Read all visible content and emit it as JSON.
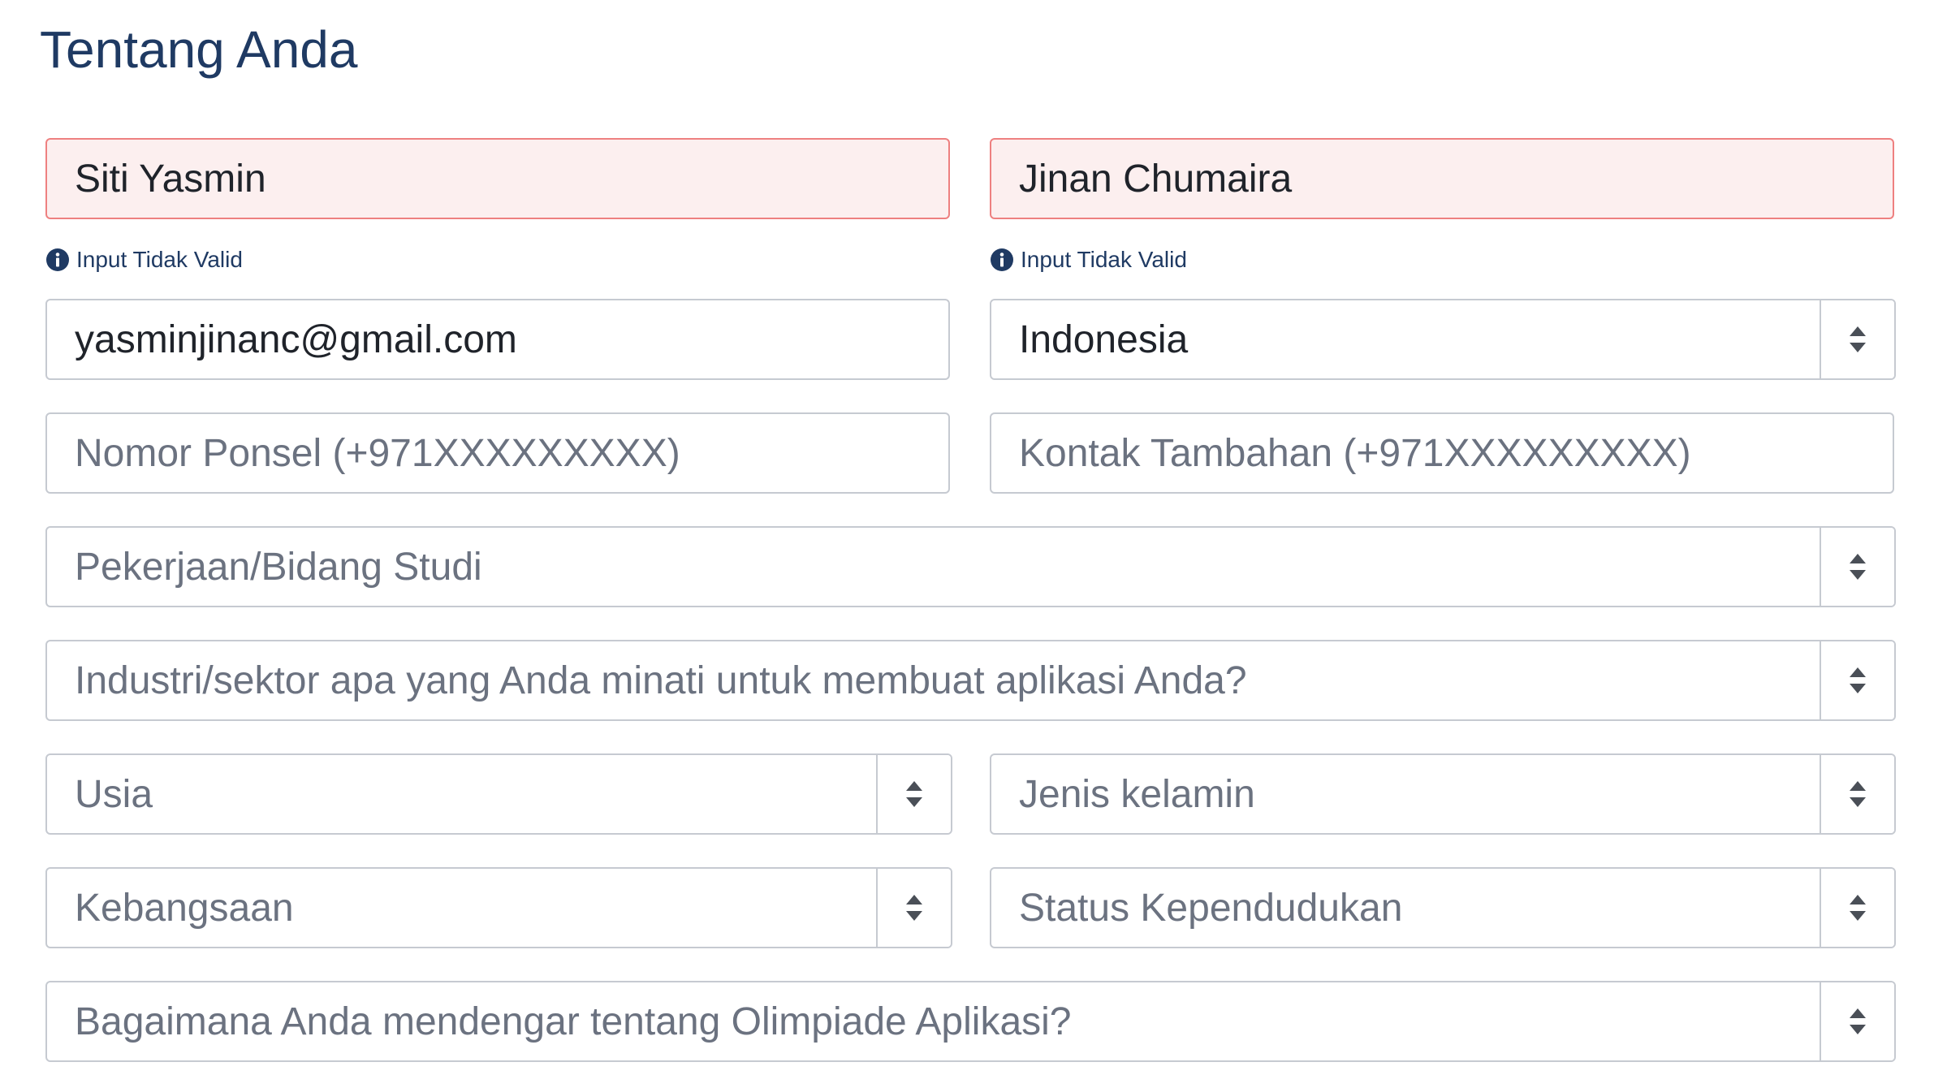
{
  "page_title": "Tentang Anda",
  "first_name": {
    "value": "Siti Yasmin",
    "error": "Input Tidak Valid"
  },
  "last_name": {
    "value": "Jinan Chumaira",
    "error": "Input Tidak Valid"
  },
  "email": {
    "value": "yasminjinanc@gmail.com"
  },
  "country": {
    "value": "Indonesia"
  },
  "mobile": {
    "placeholder": "Nomor Ponsel (+971XXXXXXXXX)"
  },
  "additional_contact": {
    "placeholder": "Kontak Tambahan (+971XXXXXXXXX)"
  },
  "occupation": {
    "placeholder": "Pekerjaan/Bidang Studi"
  },
  "industry": {
    "placeholder": "Industri/sektor apa yang Anda minati untuk membuat aplikasi Anda?"
  },
  "age": {
    "placeholder": "Usia"
  },
  "gender": {
    "placeholder": "Jenis kelamin"
  },
  "nationality": {
    "placeholder": "Kebangsaan"
  },
  "residency_status": {
    "placeholder": "Status Kependudukan"
  },
  "referral_source": {
    "placeholder": "Bagaimana Anda mendengar tentang Olimpiade Aplikasi?"
  },
  "colors": {
    "title": "#1f3a63",
    "invalid_bg": "#fcefef",
    "invalid_border": "#ee8080",
    "border": "#c6cad1",
    "placeholder": "#6b7280",
    "text": "#1f232a"
  },
  "icons": {
    "info": "info-circle-icon",
    "select": "sort-arrows-icon"
  }
}
